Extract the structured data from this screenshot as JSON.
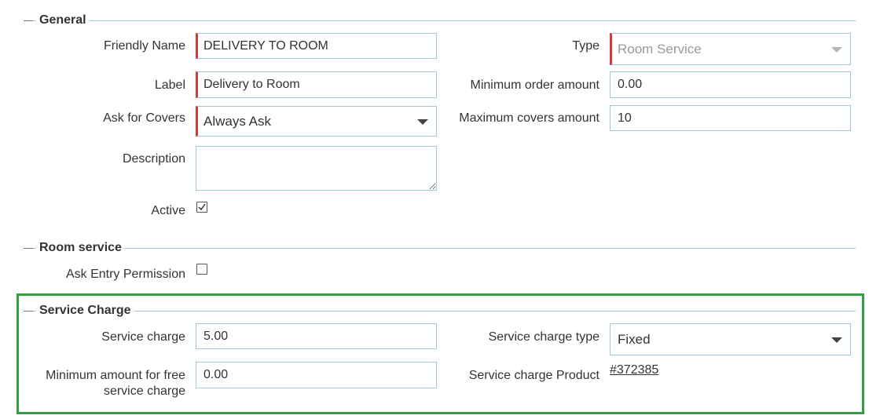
{
  "general": {
    "legend": "General",
    "friendly_name_label": "Friendly Name",
    "friendly_name_value": "DELIVERY TO ROOM",
    "label_label": "Label",
    "label_value": "Delivery to Room",
    "ask_covers_label": "Ask for Covers",
    "ask_covers_value": "Always Ask",
    "description_label": "Description",
    "description_value": "",
    "active_label": "Active",
    "active_checked": true,
    "type_label": "Type",
    "type_value": "Room Service",
    "min_order_label": "Minimum order amount",
    "min_order_value": "0.00",
    "max_covers_label": "Maximum covers amount",
    "max_covers_value": "10"
  },
  "room_service": {
    "legend": "Room service",
    "ask_entry_label": "Ask Entry Permission",
    "ask_entry_checked": false
  },
  "service_charge": {
    "legend": "Service Charge",
    "charge_label": "Service charge",
    "charge_value": "5.00",
    "min_free_label_line1": "Minimum amount for free",
    "min_free_label_line2": "service charge",
    "min_free_value": "0.00",
    "type_label": "Service charge type",
    "type_value": "Fixed",
    "product_label": "Service charge Product",
    "product_link": "#372385"
  },
  "colors": {
    "required_border": "#d7363b",
    "field_border": "#9fc9d8",
    "highlight_border": "#2ea140"
  }
}
